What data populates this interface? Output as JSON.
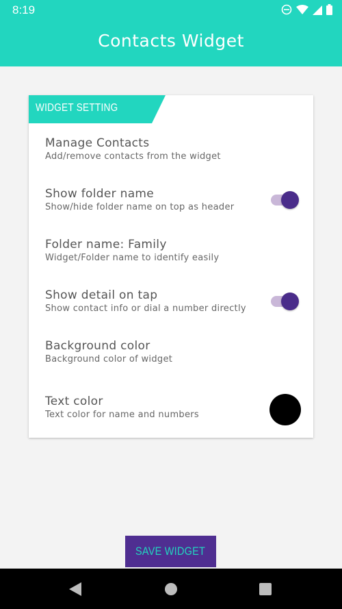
{
  "status_bar": {
    "time": "8:19"
  },
  "app_bar": {
    "title": "Contacts Widget"
  },
  "card": {
    "header": "WIDGET SETTING",
    "items": [
      {
        "title": "Manage Contacts",
        "subtitle": "Add/remove contacts from the widget"
      },
      {
        "title": "Show folder name",
        "subtitle": "Show/hide folder name on top as header",
        "toggle": true
      },
      {
        "title": "Folder name: Family",
        "subtitle": "Widget/Folder name to identify easily"
      },
      {
        "title": "Show detail on tap",
        "subtitle": "Show contact info or dial a number directly",
        "toggle": true
      },
      {
        "title": "Background color",
        "subtitle": "Background color of widget"
      },
      {
        "title": "Text color",
        "subtitle": "Text color for name and numbers",
        "swatch": "#000000"
      }
    ]
  },
  "save_button": {
    "label": "SAVE WIDGET"
  },
  "colors": {
    "accent": "#22d6bf",
    "primary": "#4f2e91",
    "toggle_thumb": "#4a2c8a",
    "toggle_track": "#c9b7d8"
  },
  "icons": [
    "dnd-icon",
    "wifi-icon",
    "signal-icon",
    "battery-icon",
    "back-icon",
    "home-icon",
    "recents-icon"
  ]
}
